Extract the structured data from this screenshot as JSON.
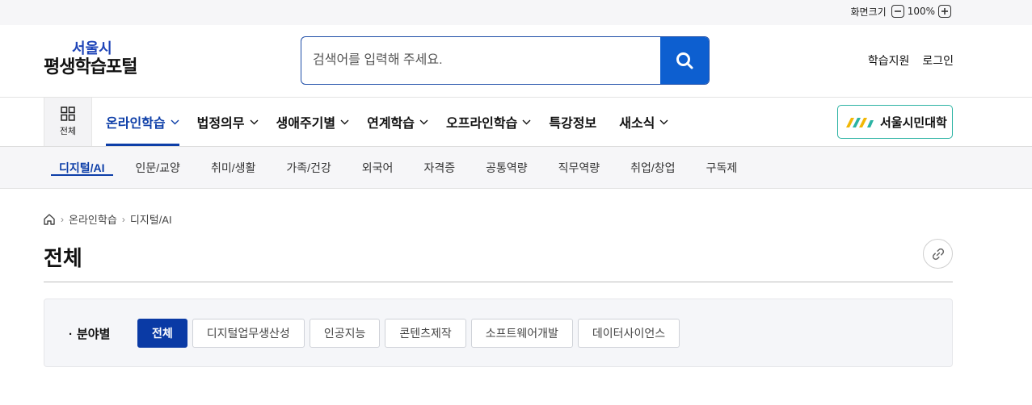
{
  "topbar": {
    "zoom_label": "화면크기",
    "zoom_value": "100%",
    "zoom_minus": "−",
    "zoom_plus": "+"
  },
  "header": {
    "logo_line1": "서울시",
    "logo_line2": "평생학습포털",
    "search_placeholder": "검색어를 입력해 주세요.",
    "links": [
      "학습지원",
      "로그인"
    ]
  },
  "gnb": {
    "all_menu_label": "전체",
    "items": [
      {
        "label": "온라인학습",
        "active": true,
        "dropdown": true
      },
      {
        "label": "법정의무",
        "dropdown": true
      },
      {
        "label": "생애주기별",
        "dropdown": true
      },
      {
        "label": "연계학습",
        "dropdown": true
      },
      {
        "label": "오프라인학습",
        "dropdown": true
      },
      {
        "label": "특강정보",
        "dropdown": false
      },
      {
        "label": "새소식",
        "dropdown": true
      }
    ],
    "citizen_univ": "서울시민대학"
  },
  "subnav": {
    "items": [
      "디지털/AI",
      "인문/교양",
      "취미/생활",
      "가족/건강",
      "외국어",
      "자격증",
      "공통역량",
      "직무역량",
      "취업/창업",
      "구독제"
    ],
    "active_index": 0
  },
  "breadcrumb": [
    "온라인학습",
    "디지털/AI"
  ],
  "page_title": "전체",
  "filter": {
    "label": "분야별",
    "chips": [
      "전체",
      "디지털업무생산성",
      "인공지능",
      "콘텐츠제작",
      "소프트웨어개발",
      "데이터사이언스"
    ],
    "active_index": 0
  },
  "colors": {
    "primary": "#0d3ea8",
    "search_button": "#0d5fd0",
    "citizen_border": "#2bb3a3"
  }
}
